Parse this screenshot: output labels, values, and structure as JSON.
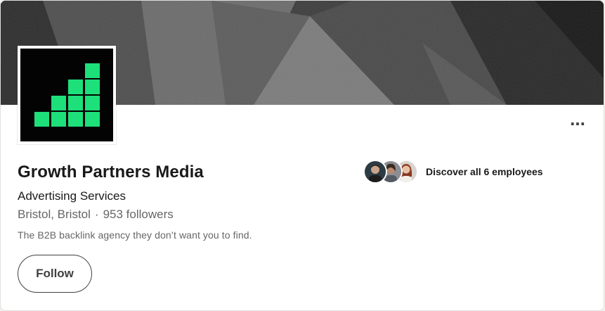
{
  "company": {
    "name": "Growth Partners Media",
    "industry": "Advertising Services",
    "location": "Bristol, Bristol",
    "separator": "·",
    "followers": "953 followers",
    "tagline": "The B2B backlink agency they don’t want you to find."
  },
  "actions": {
    "follow_label": "Follow",
    "more_label": "..."
  },
  "employees": {
    "label": "Discover all 6 employees"
  },
  "colors": {
    "logo_green": "#1de07a",
    "logo_background": "#030303",
    "cover_tone": "#3c3c3c"
  },
  "icons": {
    "more": "overflow-menu-icon"
  }
}
